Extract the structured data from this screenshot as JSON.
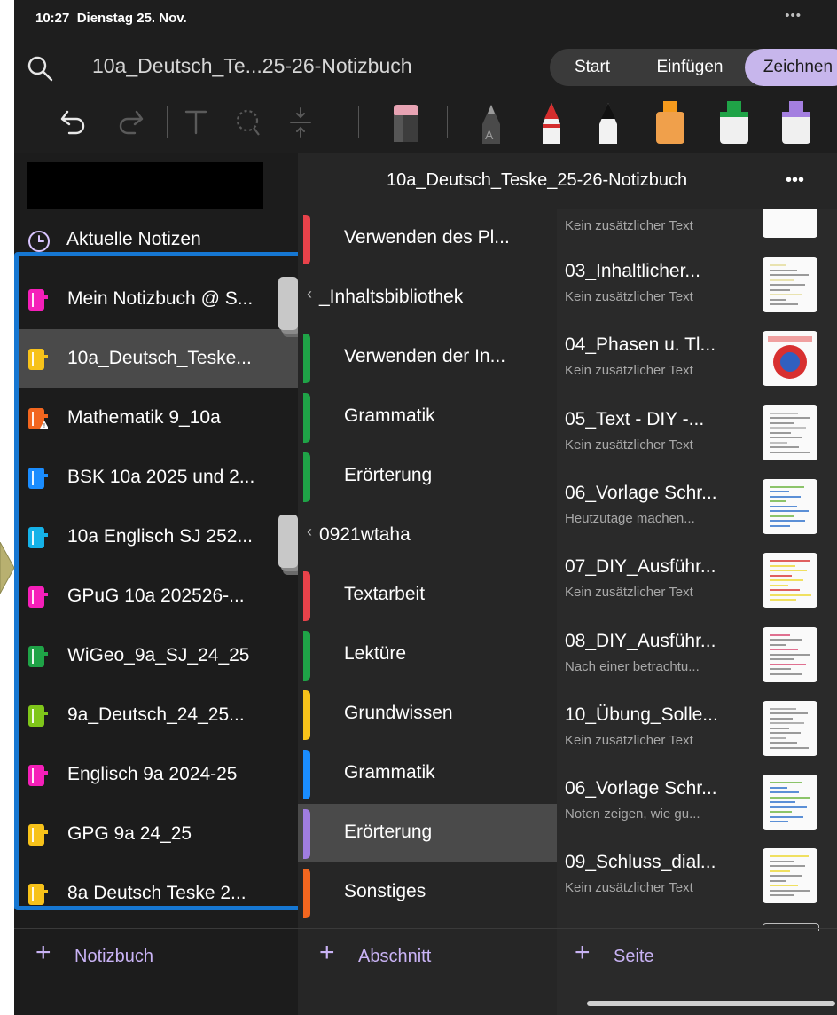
{
  "status": {
    "time": "10:27",
    "date": "Dienstag 25. Nov.",
    "more": "•••"
  },
  "header": {
    "notebook_title": "10a_Deutsch_Te...25-26-Notizbuch",
    "tabs": [
      "Start",
      "Einfügen",
      "Zeichnen"
    ],
    "active_tab": "Zeichnen"
  },
  "sidebar": {
    "recent_label": "Aktuelle Notizen",
    "notebooks": [
      {
        "label": "Mein Notizbuch @ S...",
        "color": "#f51fb9"
      },
      {
        "label": "10a_Deutsch_Teske...",
        "color": "#f7c21a"
      },
      {
        "label": "Mathematik 9_10a",
        "color": "#f2661f"
      },
      {
        "label": "BSK 10a 2025 und 2...",
        "color": "#1a8dff"
      },
      {
        "label": "10a Englisch SJ 252...",
        "color": "#15b2e8"
      },
      {
        "label": "GPuG 10a 202526-...",
        "color": "#f51fb9"
      },
      {
        "label": "WiGeo_9a_SJ_24_25",
        "color": "#1fa347"
      },
      {
        "label": "9a_Deutsch_24_25...",
        "color": "#7fc61a"
      },
      {
        "label": "Englisch 9a 2024-25",
        "color": "#f51fb9"
      },
      {
        "label": "GPG 9a 24_25",
        "color": "#f7c21a"
      },
      {
        "label": "8a Deutsch Teske 2...",
        "color": "#f7c21a"
      }
    ],
    "add_label": "Notizbuch"
  },
  "sections": {
    "header_title": "10a_Deutsch_Teske_25-26-Notizbuch",
    "more": "•••",
    "items": [
      {
        "type": "section",
        "label": "Verwenden des Pl...",
        "color": "#e8424a"
      },
      {
        "type": "group",
        "label": "_Inhaltsbibliothek"
      },
      {
        "type": "section",
        "label": "Verwenden der In...",
        "color": "#1fa347"
      },
      {
        "type": "section",
        "label": "Grammatik",
        "color": "#1fa347"
      },
      {
        "type": "section",
        "label": "Erörterung",
        "color": "#1fa347"
      },
      {
        "type": "group",
        "label": "0921wtaha"
      },
      {
        "type": "section",
        "label": "Textarbeit",
        "color": "#e8424a"
      },
      {
        "type": "section",
        "label": "Lektüre",
        "color": "#1fa347"
      },
      {
        "type": "section",
        "label": "Grundwissen",
        "color": "#f7c21a"
      },
      {
        "type": "section",
        "label": "Grammatik",
        "color": "#1a8dff"
      },
      {
        "type": "section",
        "label": "Erörterung",
        "color": "#a07de0"
      },
      {
        "type": "section",
        "label": "Sonstiges",
        "color": "#f2661f"
      }
    ],
    "add_label": "Abschnitt"
  },
  "pages": {
    "top_partial_sub": "Kein zusätzlicher Text",
    "items": [
      {
        "title": "03_Inhaltlicher...",
        "sub": "Kein zusätzlicher Text"
      },
      {
        "title": "04_Phasen u. Tl...",
        "sub": "Kein zusätzlicher Text"
      },
      {
        "title": "05_Text - DIY -...",
        "sub": "Kein zusätzlicher Text"
      },
      {
        "title": "06_Vorlage Schr...",
        "sub": "Heutzutage machen..."
      },
      {
        "title": "07_DIY_Ausführ...",
        "sub": "Kein zusätzlicher Text"
      },
      {
        "title": "08_DIY_Ausführ...",
        "sub": "Nach einer betrachtu..."
      },
      {
        "title": "10_Übung_Solle...",
        "sub": "Kein zusätzlicher Text"
      },
      {
        "title": "06_Vorlage Schr...",
        "sub": "Noten zeigen, wie gu..."
      },
      {
        "title": "09_Schluss_dial...",
        "sub": "Kein zusätzlicher Text"
      }
    ],
    "add_label": "Seite"
  }
}
